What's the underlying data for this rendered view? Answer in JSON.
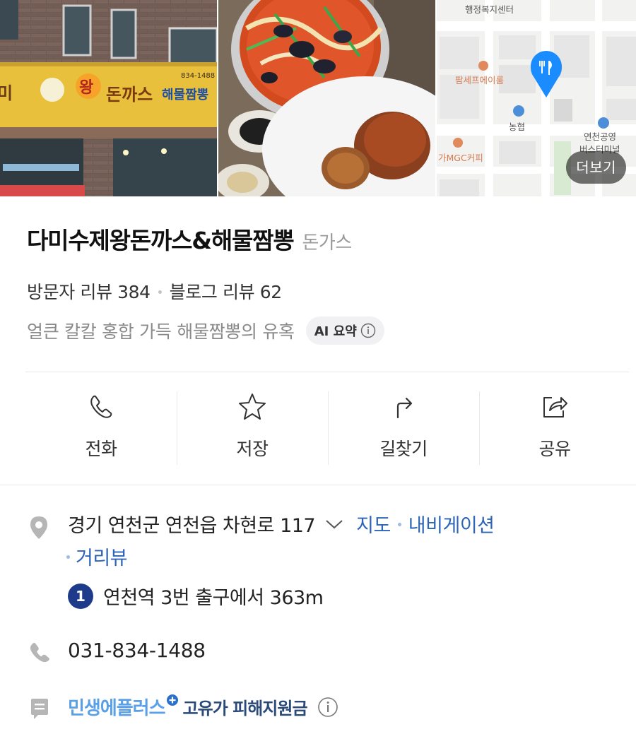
{
  "photos": {
    "more_label": "더보기",
    "storefront_sign": "미 숇 왕 돈까스 & 해물짬뽕",
    "storefront_phone": "834-1488",
    "map": {
      "labels": [
        "행정복지센터",
        "팜세프에이룸",
        "농협",
        "가MGC커피",
        "연천공영",
        "버스터미널"
      ]
    }
  },
  "place": {
    "name": "다미수제왕돈까스&해물짬뽕",
    "category": "돈가스"
  },
  "reviews": {
    "visitor": "방문자 리뷰 384",
    "blog": "블로그 리뷰 62"
  },
  "summary": {
    "text": "얼큰 칼칼 홍합 가득 해물짬뽕의 유혹",
    "ai_badge": "AI 요약"
  },
  "actions": [
    {
      "label": "전화",
      "icon": "phone-icon"
    },
    {
      "label": "저장",
      "icon": "star-icon"
    },
    {
      "label": "길찾기",
      "icon": "directions-icon"
    },
    {
      "label": "공유",
      "icon": "share-icon"
    }
  ],
  "address": {
    "text": "경기 연천군 연천읍 차현로 117",
    "map_link": "지도",
    "navigation_link": "내비게이션",
    "streetview_link": "거리뷰"
  },
  "subway": {
    "line": "1",
    "line_color": "#1e3a8a",
    "text": "연천역 3번 출구에서 363m"
  },
  "phone": "031-834-1488",
  "promo": {
    "brand": "민생에플러스",
    "text": "고유가 피해지원금"
  },
  "colors": {
    "link": "#2d64b7",
    "map_pin": "#1a8cff",
    "text_secondary": "#9a9a9a"
  }
}
